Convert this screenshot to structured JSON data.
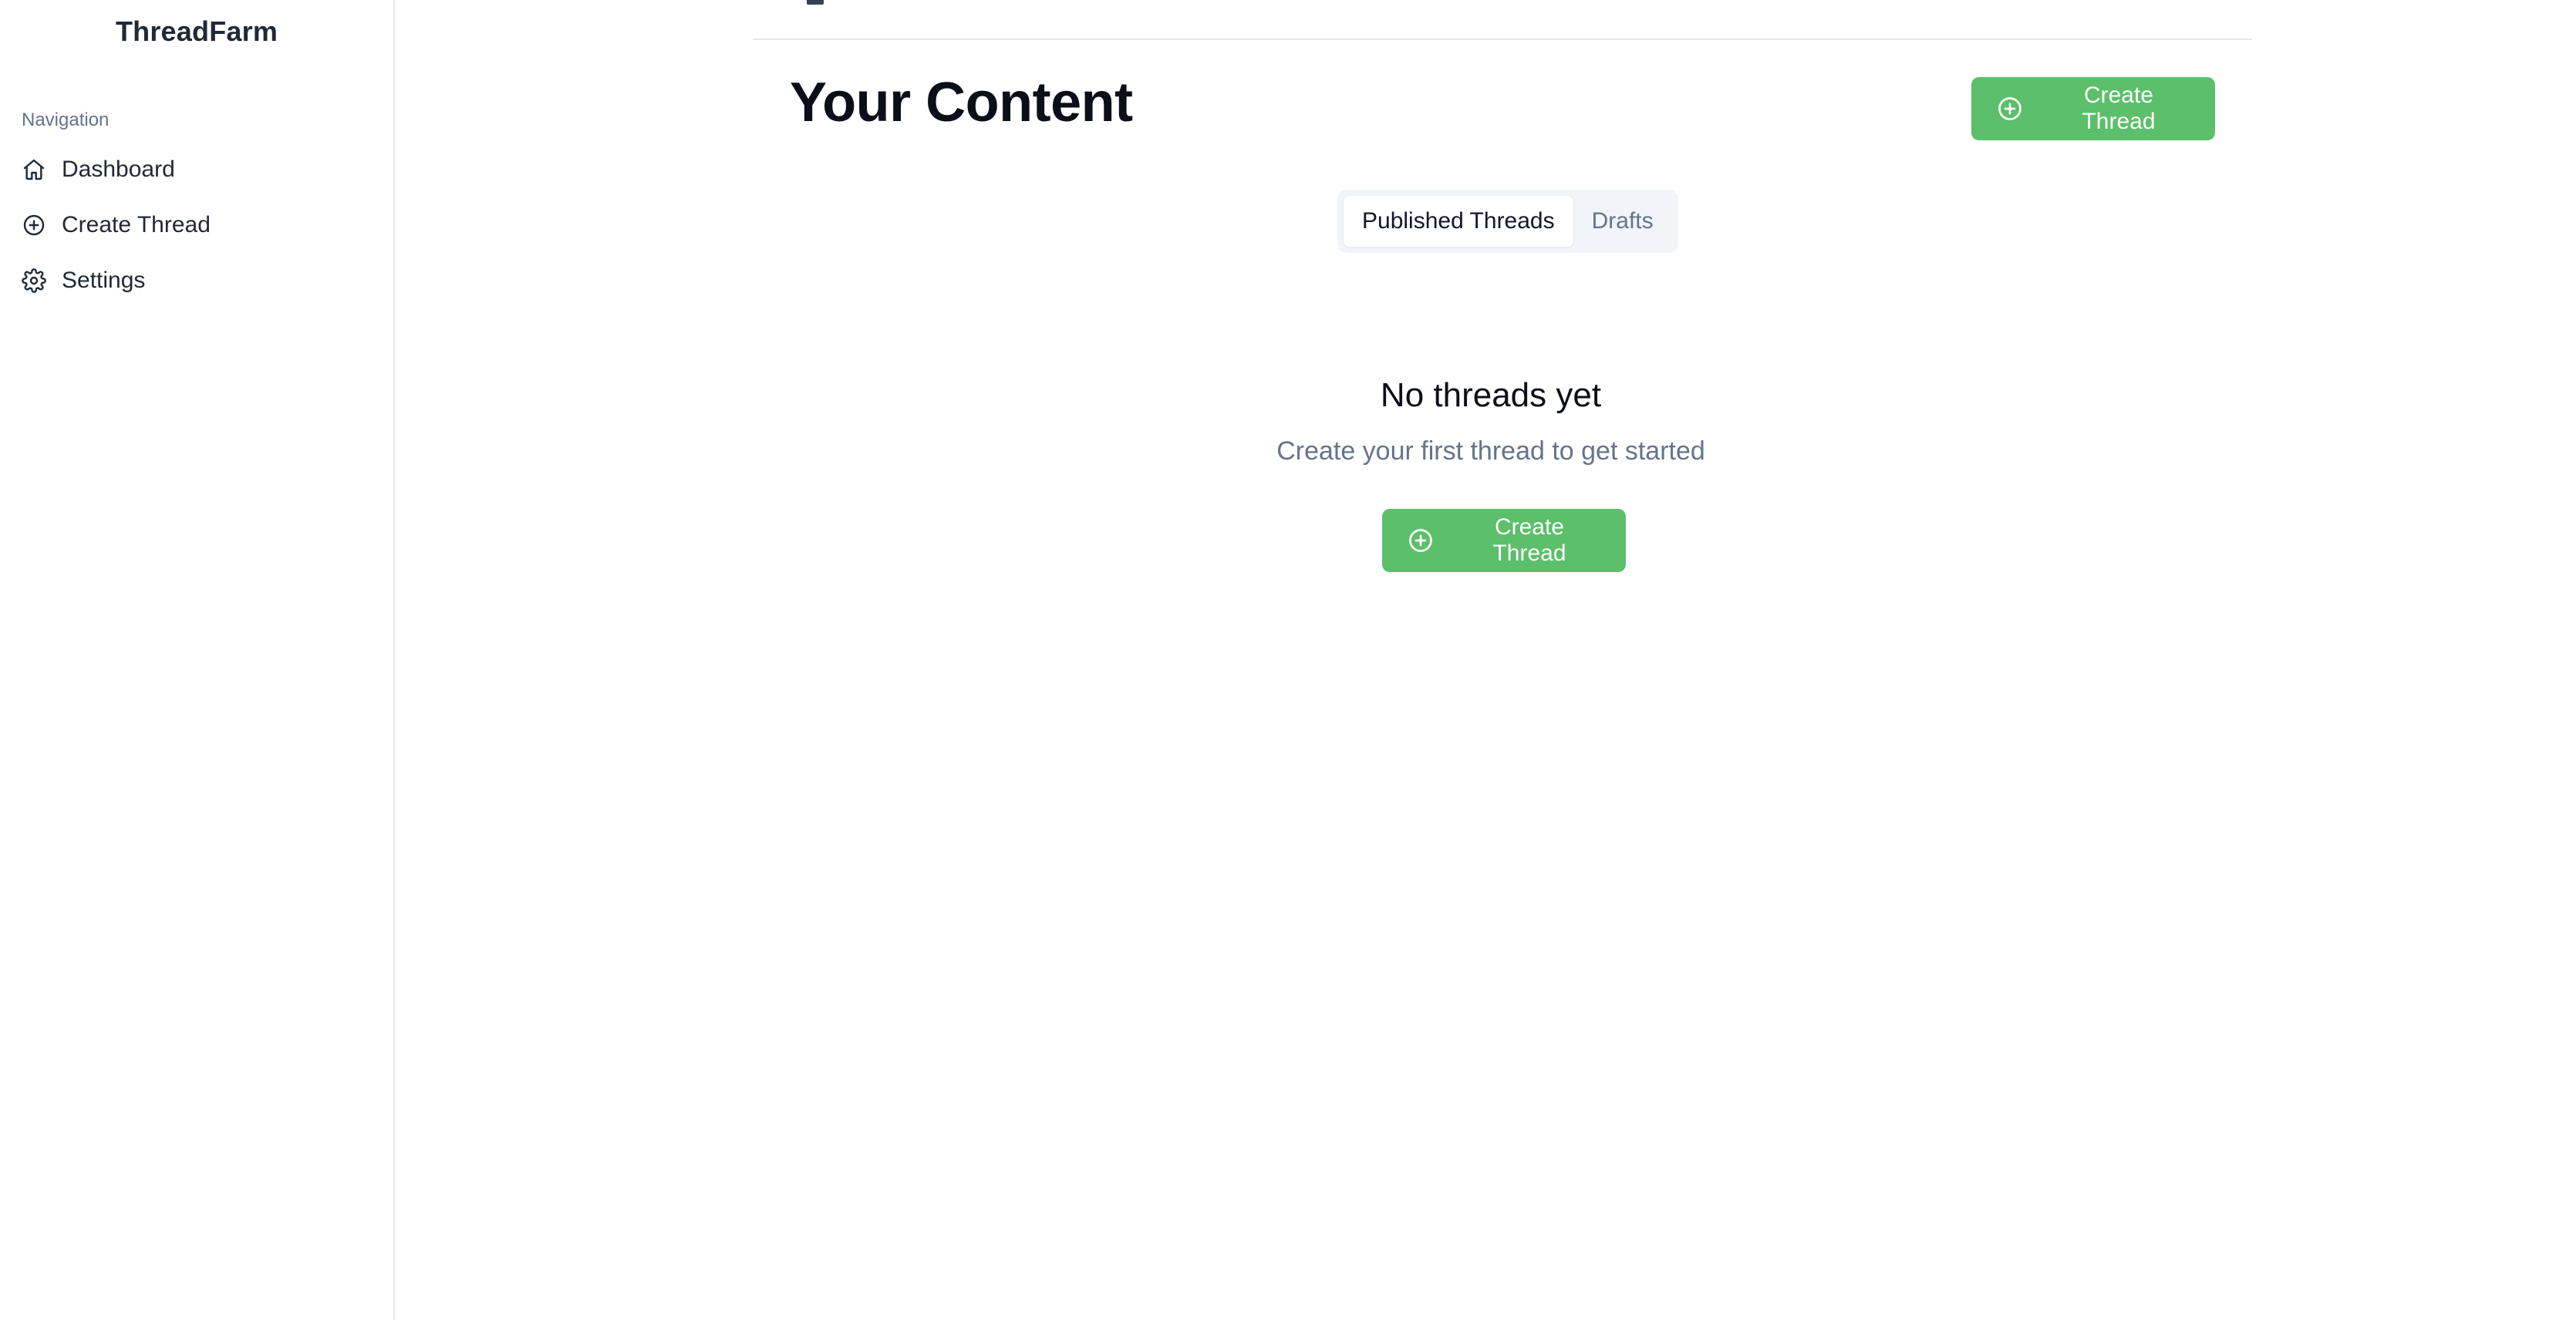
{
  "app": {
    "brand": "ThreadFarm"
  },
  "sidebar": {
    "heading": "Navigation",
    "items": [
      {
        "label": "Dashboard",
        "icon": "home-icon"
      },
      {
        "label": "Create Thread",
        "icon": "plus-circle-icon"
      },
      {
        "label": "Settings",
        "icon": "gear-icon"
      }
    ]
  },
  "main": {
    "title": "Your Content",
    "create_button_label": "Create Thread",
    "tabs": [
      {
        "label": "Published Threads",
        "active": true
      },
      {
        "label": "Drafts",
        "active": false
      }
    ],
    "empty_state": {
      "title": "No threads yet",
      "subtitle": "Create your first thread to get started",
      "button_label": "Create Thread"
    }
  },
  "colors": {
    "accent_green": "#5cbf6a",
    "muted_text": "#64748b",
    "tab_track": "#f1f5f9",
    "border": "#e5e7eb"
  }
}
